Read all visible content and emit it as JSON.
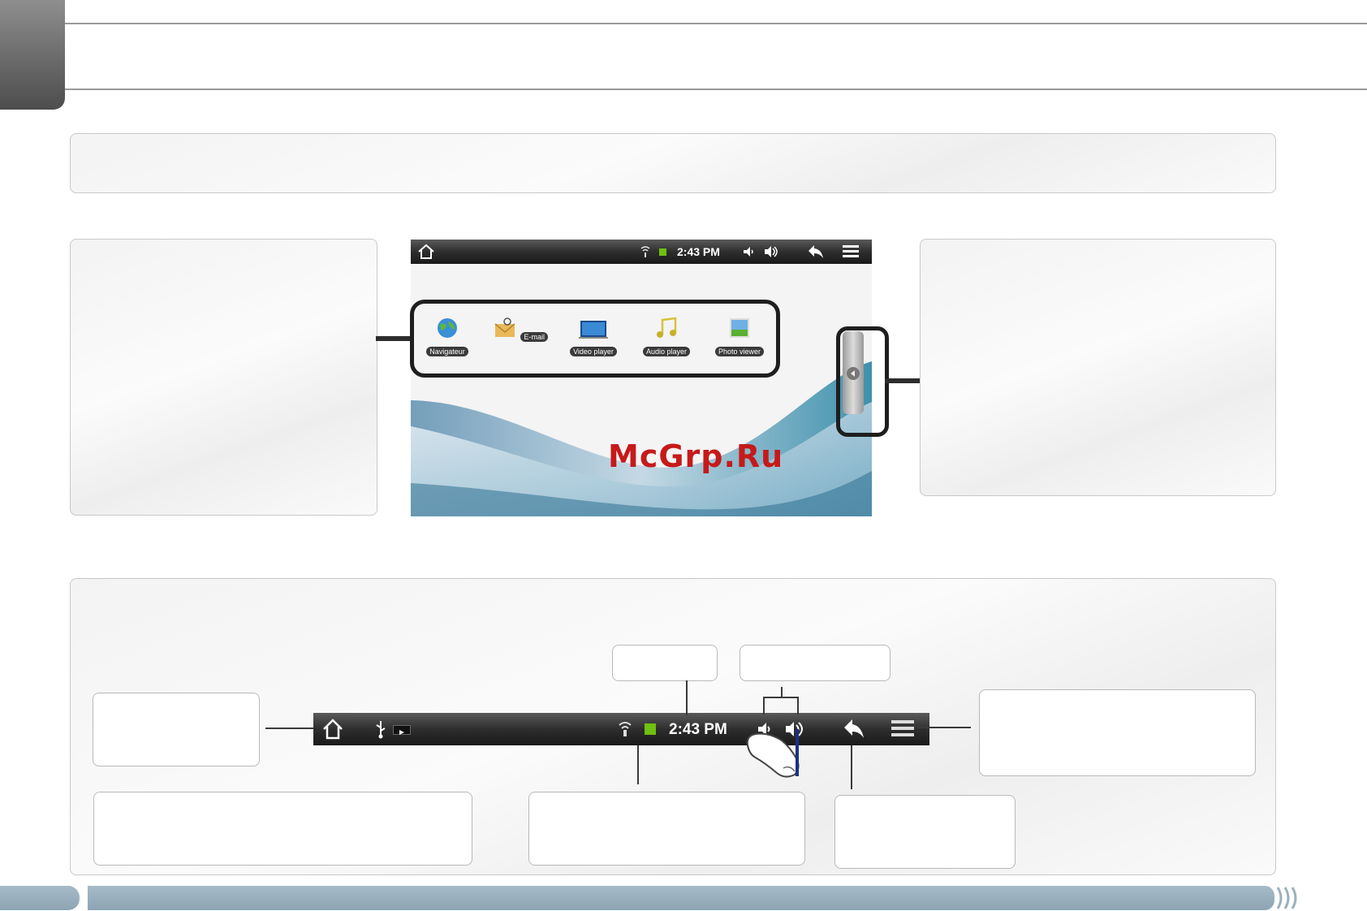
{
  "device_status_bar": {
    "time": "2:43 PM"
  },
  "apps": [
    {
      "label": "Navigateur",
      "icon": "globe-icon"
    },
    {
      "label": "E-mail",
      "icon": "mail-icon"
    },
    {
      "label": "Video player",
      "icon": "video-icon"
    },
    {
      "label": "Audio player",
      "icon": "music-icon"
    },
    {
      "label": "Photo viewer",
      "icon": "photo-icon"
    }
  ],
  "watermark": "McGrp.Ru",
  "large_status_bar": {
    "time": "2:43 PM"
  },
  "footer": {
    "page_number": ""
  },
  "colors": {
    "footer_accent": "#9ab0be",
    "watermark": "#c61a1a",
    "battery": "#6fc010"
  }
}
